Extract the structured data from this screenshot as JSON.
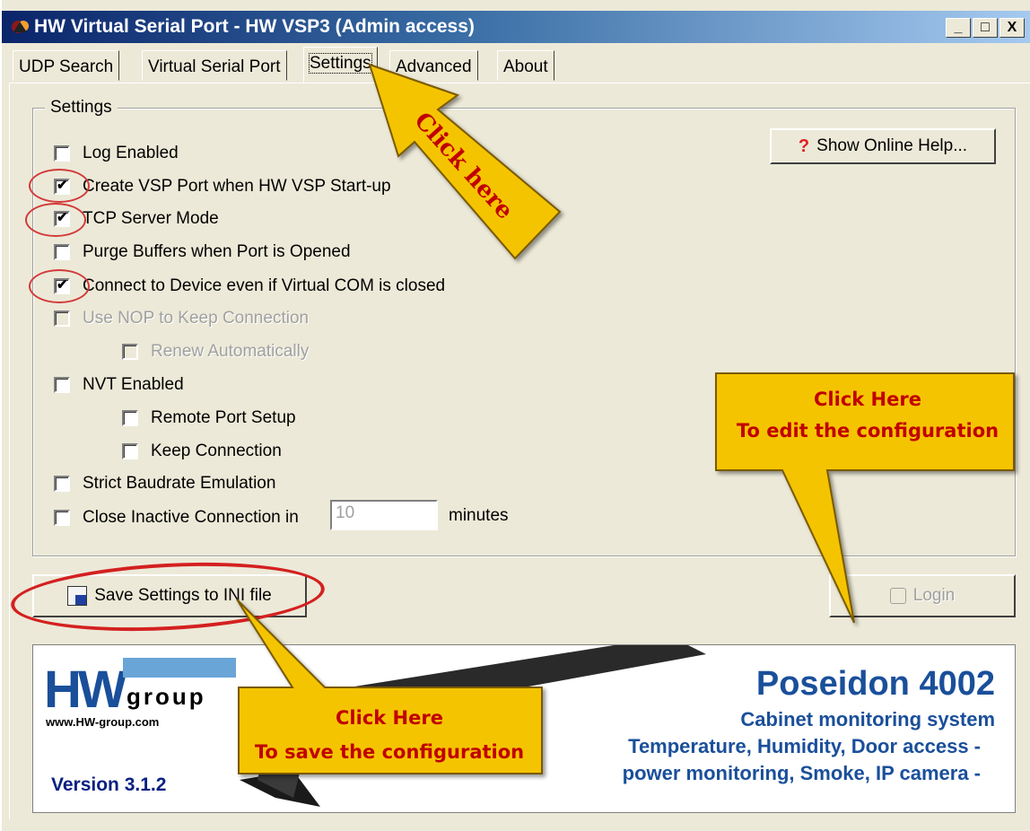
{
  "window": {
    "title": "HW Virtual Serial Port - HW VSP3 (Admin access)",
    "controls": [
      "_",
      "□",
      "X"
    ]
  },
  "tabs": [
    {
      "label": "UDP Search"
    },
    {
      "label": "Virtual Serial Port"
    },
    {
      "label": "Settings",
      "active": true
    },
    {
      "label": "Advanced"
    },
    {
      "label": "About"
    }
  ],
  "settings": {
    "group_title": "Settings",
    "help_button": "Show Online Help...",
    "options": [
      {
        "label": "Log Enabled",
        "checked": false
      },
      {
        "label": "Create VSP Port when HW VSP Start-up",
        "checked": true
      },
      {
        "label": "TCP Server Mode",
        "checked": true
      },
      {
        "label": "Purge Buffers when Port is Opened",
        "checked": false
      },
      {
        "label": "Connect to Device even if Virtual COM is closed",
        "checked": true
      },
      {
        "label": "Use NOP to Keep Connection",
        "checked": false,
        "disabled": true
      },
      {
        "label": "Renew Automatically",
        "checked": false,
        "disabled": true
      },
      {
        "label": "NVT Enabled",
        "checked": false
      },
      {
        "label": "Remote Port Setup",
        "checked": false
      },
      {
        "label": "Keep Connection",
        "checked": false
      },
      {
        "label": "Strict Baudrate Emulation",
        "checked": false
      },
      {
        "label": "Close Inactive Connection in",
        "checked": false
      }
    ],
    "inactive_minutes": "10",
    "minutes_label": "minutes"
  },
  "buttons": {
    "save": "Save Settings to INI file",
    "login": "Login"
  },
  "annotations": {
    "click_tab": "Click here",
    "edit_line1": "Click Here",
    "edit_line2": "To edit the configuration",
    "save_line1": "Click Here",
    "save_line2": "To save the configuration"
  },
  "banner": {
    "logo_text": "group",
    "url": "www.HW-group.com",
    "version": "Version  3.1.2",
    "product": "Poseidon 4002",
    "subtitle": "Cabinet monitoring system",
    "line1": "Temperature, Humidity, Door access -",
    "line2": "power monitoring, Smoke, IP camera -"
  },
  "colors": {
    "accent_red": "#c00000",
    "callout_yellow": "#f5c400",
    "banner_blue": "#1a4f9a"
  }
}
